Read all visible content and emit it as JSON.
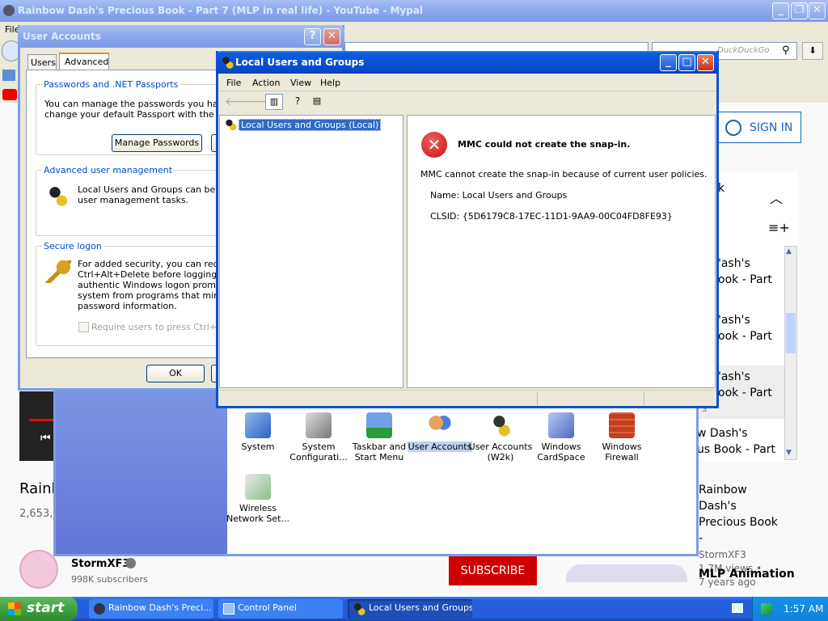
{
  "browser": {
    "title": "Rainbow Dash's Precious Book - Part 7 (MLP in real life) - YouTube - Mypal",
    "menu_file": "File",
    "search_placeholder": "DuckDuckGo"
  },
  "youtube": {
    "sign_in": "SIGN IN",
    "list_partial": "k",
    "video_titles": [
      "Rainbow Dash's Precious Book - Part",
      "Rainbow Dash's Precious Book - Part",
      "Rainbow Dash's Precious Book - Part",
      "Rainbow Dash's Precious Book - Part"
    ],
    "video_titles_visible": [
      "'ash's\nook - Part",
      "'ash's\nook - Part",
      "'ash's\nook - Part",
      "w Dash's\nus Book - Part"
    ],
    "rec_title": "Rainbow Dash's Precious Book -",
    "rec_channel": "StormXF3",
    "rec_views": "1.7M views •",
    "rec_age": "7 years ago",
    "next_title": "MLP Animation",
    "main_title_partial": "Rainb",
    "views_partial": "2,653,8",
    "channel": "StormXF3",
    "subscribers": "998K subscribers",
    "subscribe": "SUBSCRIBE",
    "queue_small": "3"
  },
  "user_accounts": {
    "title": "User Accounts",
    "tabs": [
      "Users",
      "Advanced"
    ],
    "groups": {
      "passports": {
        "title": "Passwords and .NET Passports",
        "text": "You can manage the passwords you have st\nchange your default Passport with the .NET",
        "button": "Manage Passwords"
      },
      "adv": {
        "title": "Advanced user management",
        "text": "Local Users and Groups can be used\nuser management tasks."
      },
      "secure": {
        "title": "Secure logon",
        "text": "For added security, you can require\nCtrl+Alt+Delete before logging on.\nauthentic Windows logon prompt ap\nsystem from programs that mimic a\npassword information.",
        "checkbox": "Require users to press Ctrl+Alt+"
      }
    },
    "ok": "OK"
  },
  "mmc": {
    "title": "Local Users and Groups",
    "menu": [
      "File",
      "Action",
      "View",
      "Help"
    ],
    "tree_item": "Local Users and Groups (Local)",
    "error_title": "MMC could not create the snap-in.",
    "error_text": "MMC cannot create the snap-in because of current user policies.",
    "name_line": "Name: Local Users and Groups",
    "clsid_line": "CLSID: {5D6179C8-17EC-11D1-9AA9-00C04FD8FE93}"
  },
  "control_panel": {
    "icons": [
      {
        "label": "System",
        "name": "system-icon"
      },
      {
        "label": "System Configurati...",
        "name": "system-config-icon"
      },
      {
        "label": "Taskbar and Start Menu",
        "name": "taskbar-icon"
      },
      {
        "label": "User Accounts",
        "name": "user-accounts-icon"
      },
      {
        "label": "User Accounts (W2k)",
        "name": "user-accounts-w2k-icon"
      },
      {
        "label": "Windows CardSpace",
        "name": "cardspace-icon"
      },
      {
        "label": "Windows Firewall",
        "name": "firewall-icon"
      },
      {
        "label": "Wireless Network Set...",
        "name": "wireless-icon"
      }
    ]
  },
  "taskbar": {
    "start": "start",
    "items": [
      "Rainbow Dash's Preci...",
      "Control Panel",
      "Local Users and Groups"
    ],
    "clock": "1:57 AM"
  },
  "colors": {
    "xp_blue": "#0a52d6",
    "taskbar": "#245edb",
    "start_green": "#3c9b3c",
    "subscribe_red": "#cc0000",
    "error_red": "#d41b1b"
  }
}
